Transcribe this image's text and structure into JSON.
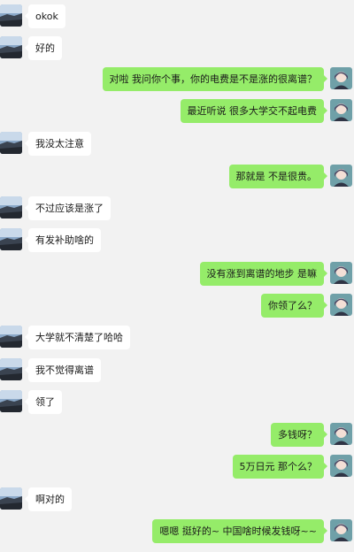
{
  "messages": [
    {
      "side": "left",
      "text": "okok"
    },
    {
      "side": "left",
      "text": "好的"
    },
    {
      "side": "right",
      "text": "对啦 我问你个事，你的电费是不是涨的很离谱？"
    },
    {
      "side": "right",
      "text": "最近听说 很多大学交不起电费"
    },
    {
      "side": "left",
      "text": "我没太注意"
    },
    {
      "side": "right",
      "text": "那就是 不是很贵。"
    },
    {
      "side": "left",
      "text": "不过应该是涨了"
    },
    {
      "side": "left",
      "text": "有发补助啥的"
    },
    {
      "side": "right",
      "text": "没有涨到离谱的地步 是嘛"
    },
    {
      "side": "right",
      "text": "你领了么？"
    },
    {
      "side": "left",
      "text": "大学就不清楚了哈哈"
    },
    {
      "side": "left",
      "text": "我不觉得离谱"
    },
    {
      "side": "left",
      "text": "领了"
    },
    {
      "side": "right",
      "text": "多钱呀？"
    },
    {
      "side": "right",
      "text": "5万日元 那个么？"
    },
    {
      "side": "left",
      "text": "啊对的"
    },
    {
      "side": "right",
      "text": "嗯嗯 挺好的~ 中国啥时候发钱呀~~"
    }
  ],
  "avatars": {
    "left": "landscape-avatar-icon",
    "right": "anime-character-avatar-icon"
  },
  "colors": {
    "background": "#f2f2f2",
    "bubble_self": "#95ec69",
    "bubble_other": "#ffffff"
  }
}
